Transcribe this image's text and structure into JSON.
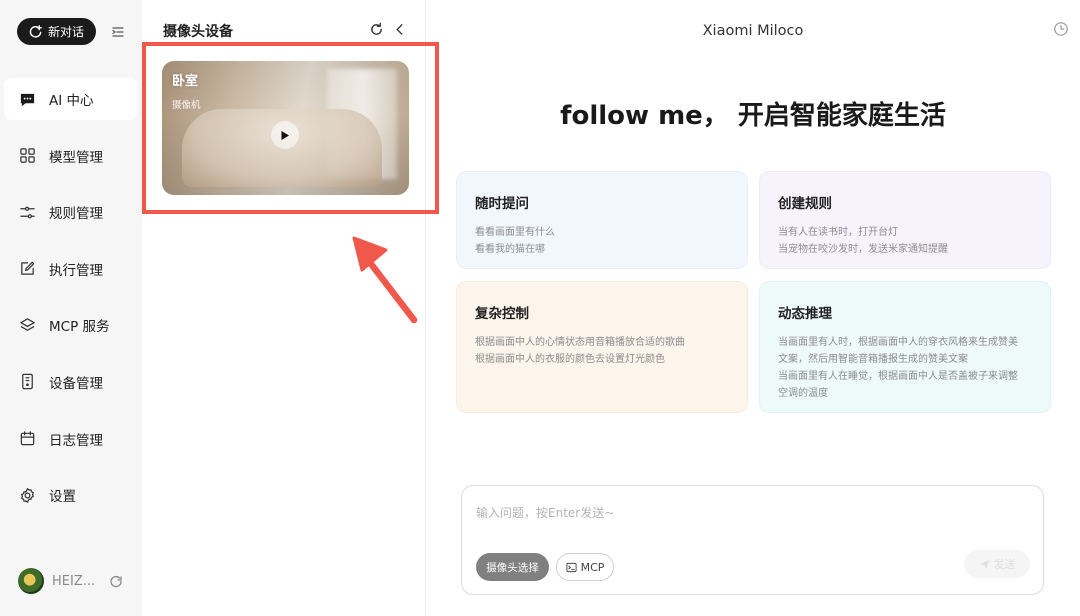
{
  "nav": {
    "new_chat_label": "新对话",
    "items": [
      {
        "label": "AI 中心",
        "icon": "chat-icon",
        "active": true
      },
      {
        "label": "模型管理",
        "icon": "grid-icon"
      },
      {
        "label": "规则管理",
        "icon": "sliders-icon"
      },
      {
        "label": "执行管理",
        "icon": "edit-icon"
      },
      {
        "label": "MCP 服务",
        "icon": "layers-icon"
      },
      {
        "label": "设备管理",
        "icon": "device-icon"
      },
      {
        "label": "日志管理",
        "icon": "calendar-icon"
      },
      {
        "label": "设置",
        "icon": "gear-icon"
      }
    ],
    "user": {
      "name": "HEIZ..."
    }
  },
  "camera_panel": {
    "title": "摄像头设备",
    "cameras": [
      {
        "name": "卧室",
        "type": "摄像机"
      }
    ]
  },
  "main": {
    "app_title": "Xiaomi Miloco",
    "hero": "follow me， 开启智能家庭生活",
    "cards": [
      {
        "title": "随时提问",
        "lines": [
          "看看画面里有什么",
          "看看我的猫在哪"
        ],
        "bg": "#f2f7fe"
      },
      {
        "title": "创建规则",
        "lines": [
          "当有人在读书时，打开台灯",
          "当宠物在咬沙发时，发送米家通知提醒"
        ],
        "bg": "#f6f3fd"
      },
      {
        "title": "复杂控制",
        "lines": [
          "根据画面中人的心情状态用音箱播放合适的歌曲",
          "根据画面中人的衣服的颜色去设置灯光颜色"
        ],
        "bg": "#fdf4ec"
      },
      {
        "title": "动态推理",
        "lines": [
          "当画面里有人时，根据画面中人的穿衣风格来生成赞美",
          "文案，然后用智能音箱播报生成的赞美文案",
          "当画面里有人在睡觉，根据画面中人是否盖被子来调整",
          "空调的温度"
        ],
        "bg": "#eefaf9"
      }
    ],
    "input": {
      "placeholder": "输入问题，按Enter发送~",
      "value": "",
      "camera_select_label": "摄像头选择",
      "mcp_label": "MCP",
      "send_label": "发送"
    }
  },
  "colors": {
    "highlight": "#f0584c",
    "accent_dark": "#1b1b1b"
  }
}
